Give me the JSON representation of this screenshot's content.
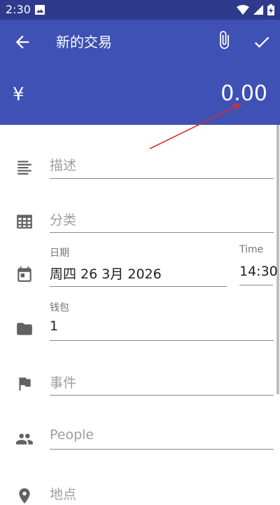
{
  "status_bar": {
    "time": "2:30"
  },
  "app_bar": {
    "title": "新的交易",
    "currency_symbol": "¥",
    "amount": "0.00",
    "color": "#3f51b5"
  },
  "form": {
    "description": {
      "placeholder": "描述",
      "icon": "notes-icon"
    },
    "category": {
      "placeholder": "分类",
      "icon": "grid-icon"
    },
    "date": {
      "label": "日期",
      "value": "周四 26 3月 2026",
      "icon": "calendar-icon"
    },
    "time": {
      "label": "Time",
      "value": "14:30"
    },
    "wallet": {
      "label": "钱包",
      "value": "1",
      "icon": "folder-icon"
    },
    "event": {
      "placeholder": "事件",
      "icon": "flag-icon"
    },
    "people": {
      "placeholder": "People",
      "icon": "people-icon"
    },
    "location": {
      "placeholder": "地点",
      "icon": "location-icon"
    }
  }
}
